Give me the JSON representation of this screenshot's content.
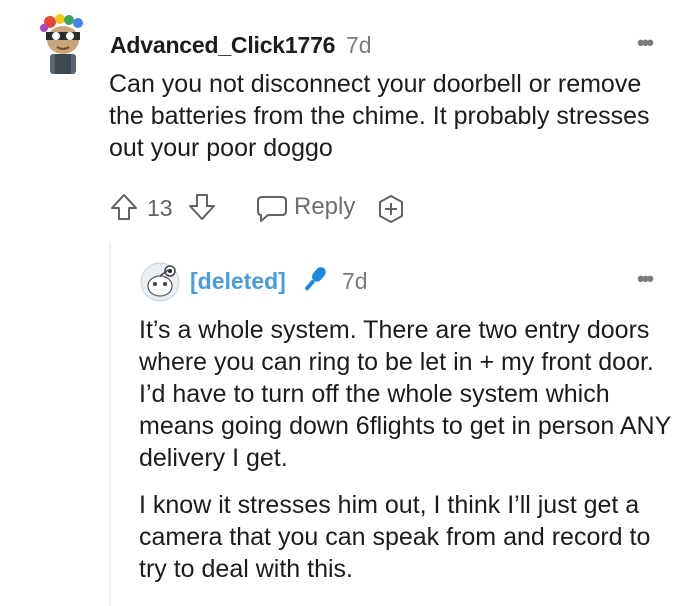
{
  "comment": {
    "author": "Advanced_Click1776",
    "time": "7d",
    "more": "•••",
    "body": "Can you not disconnect your doorbell or remove the batteries from the chime. It probably stresses out your poor doggo",
    "score": "13",
    "reply_label": "Reply"
  },
  "reply": {
    "author": "[deleted]",
    "time": "7d",
    "more": "•••",
    "paragraphs": [
      "It’s a whole system. There are two entry doors where you can ring to be let in + my front door. I’d have to turn off the whole system which means going down 6flights to get in person ANY delivery I get.",
      "I know it stresses him out, I think I’ll just get a camera that you can speak from and record to try to deal with this."
    ]
  },
  "icons": {
    "upvote": "arrow-up-outline-icon",
    "downvote": "arrow-down-outline-icon",
    "reply": "speech-bubble-icon",
    "award": "award-plus-icon",
    "mic": "microphone-icon"
  },
  "colors": {
    "deleted_user": "#4b9cdc",
    "meta_gray": "#7c7c7c",
    "mic_blue": "#1e88e5"
  }
}
